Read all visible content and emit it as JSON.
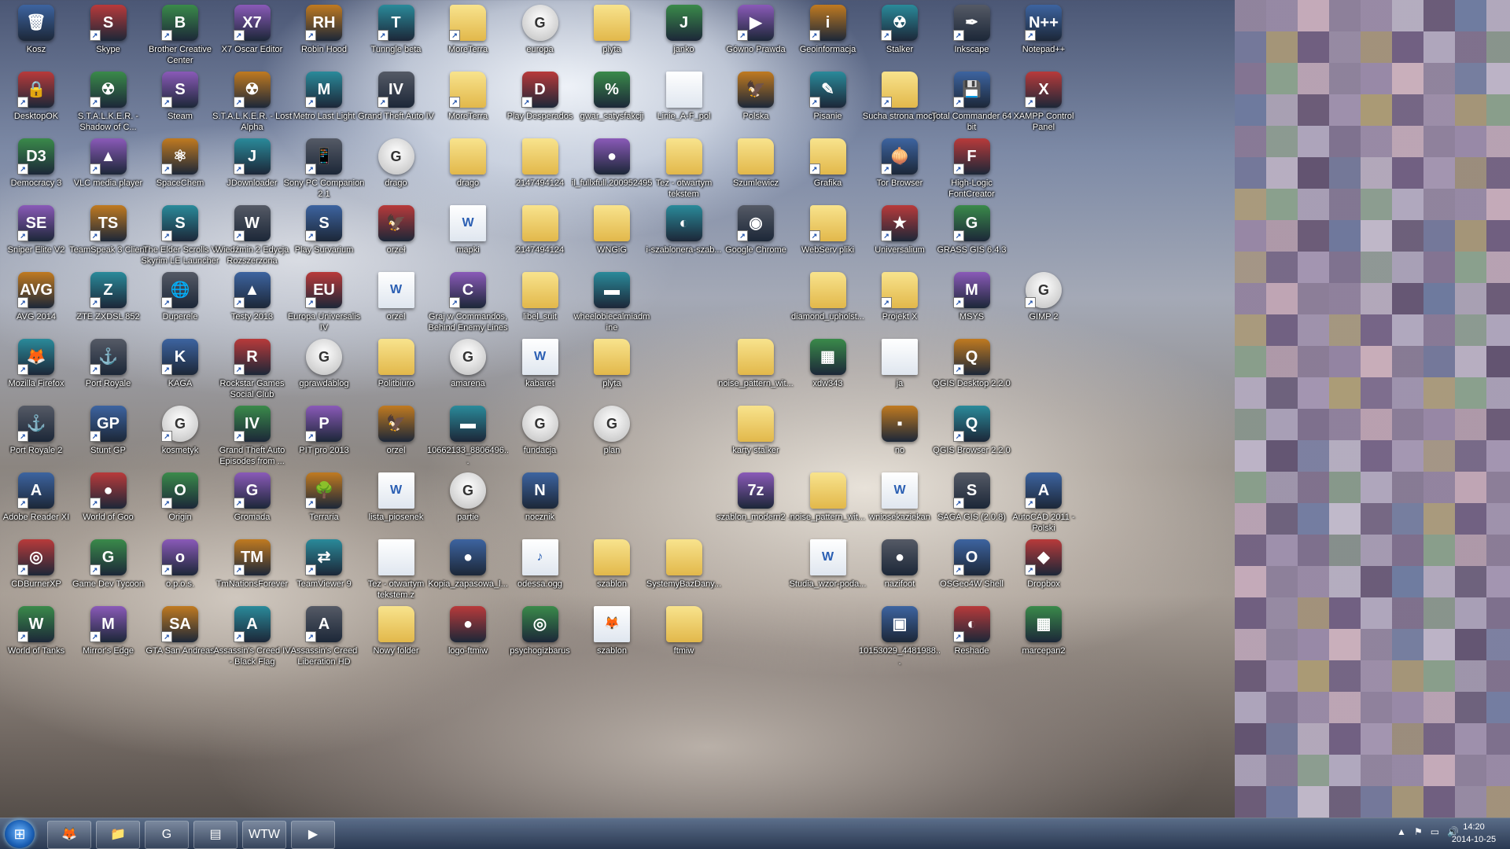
{
  "desktop": {
    "icons": [
      {
        "label": "Kosz",
        "kind": "app",
        "sym": "🗑",
        "shortcut": false
      },
      {
        "label": "Skype",
        "kind": "app",
        "sym": "S",
        "shortcut": true
      },
      {
        "label": "Brother Creative Center",
        "kind": "app",
        "sym": "B",
        "shortcut": true
      },
      {
        "label": "X7 Oscar Editor",
        "kind": "app",
        "sym": "X7",
        "shortcut": true
      },
      {
        "label": "Robin Hood",
        "kind": "app",
        "sym": "RH",
        "shortcut": true
      },
      {
        "label": "Tunngle beta",
        "kind": "app",
        "sym": "T",
        "shortcut": true
      },
      {
        "label": "MoreTerra",
        "kind": "folder",
        "sym": "",
        "shortcut": true
      },
      {
        "label": "europa",
        "kind": "gimp",
        "sym": "G",
        "shortcut": false
      },
      {
        "label": "plyta",
        "kind": "folder",
        "sym": "",
        "shortcut": false
      },
      {
        "label": "janko",
        "kind": "app",
        "sym": "J",
        "shortcut": false
      },
      {
        "label": "Gówno Prawda",
        "kind": "app",
        "sym": "▶",
        "shortcut": true
      },
      {
        "label": "Geoinformacja",
        "kind": "app",
        "sym": "i",
        "shortcut": true
      },
      {
        "label": "Stalker",
        "kind": "app",
        "sym": "☢",
        "shortcut": true
      },
      {
        "label": "Inkscape",
        "kind": "app",
        "sym": "✒",
        "shortcut": true
      },
      {
        "label": "Notepad++",
        "kind": "app",
        "sym": "N++",
        "shortcut": true
      },
      {
        "label": "DesktopOK",
        "kind": "app",
        "sym": "🔒",
        "shortcut": true
      },
      {
        "label": "S.T.A.L.K.E.R. - Shadow of C...",
        "kind": "app",
        "sym": "☢",
        "shortcut": true
      },
      {
        "label": "Steam",
        "kind": "app",
        "sym": "S",
        "shortcut": true
      },
      {
        "label": "S.T.A.L.K.E.R. - Lost Alpha",
        "kind": "app",
        "sym": "☢",
        "shortcut": true
      },
      {
        "label": "Metro Last Light",
        "kind": "app",
        "sym": "M",
        "shortcut": true
      },
      {
        "label": "Grand Theft Auto IV",
        "kind": "app",
        "sym": "IV",
        "shortcut": true
      },
      {
        "label": "MoreTerra",
        "kind": "folder",
        "sym": "",
        "shortcut": true
      },
      {
        "label": "Play Desperados",
        "kind": "app",
        "sym": "D",
        "shortcut": true
      },
      {
        "label": "gwar_satysfakcji",
        "kind": "app",
        "sym": "%",
        "shortcut": false
      },
      {
        "label": "Linie_A-F_pol",
        "kind": "doc",
        "sym": "",
        "shortcut": false
      },
      {
        "label": "Polska",
        "kind": "app",
        "sym": "🦅",
        "shortcut": false
      },
      {
        "label": "Pisanie",
        "kind": "app",
        "sym": "✎",
        "shortcut": true
      },
      {
        "label": "Sucha strona mocy",
        "kind": "folder",
        "sym": "",
        "shortcut": true
      },
      {
        "label": "Total Commander 64 bit",
        "kind": "app",
        "sym": "💾",
        "shortcut": true
      },
      {
        "label": "XAMPP Control Panel",
        "kind": "app",
        "sym": "X",
        "shortcut": true
      },
      {
        "label": "Democracy 3",
        "kind": "app",
        "sym": "D3",
        "shortcut": true
      },
      {
        "label": "VLC media player",
        "kind": "app",
        "sym": "▲",
        "shortcut": true
      },
      {
        "label": "SpaceChem",
        "kind": "app",
        "sym": "⚛",
        "shortcut": true
      },
      {
        "label": "JDownloader",
        "kind": "app",
        "sym": "J",
        "shortcut": true
      },
      {
        "label": "Sony PC Companion 2.1",
        "kind": "app",
        "sym": "📱",
        "shortcut": true
      },
      {
        "label": "drago",
        "kind": "gimp",
        "sym": "G",
        "shortcut": false
      },
      {
        "label": "drago",
        "kind": "folder",
        "sym": "",
        "shortcut": false
      },
      {
        "label": "2147494124",
        "kind": "folder",
        "sym": "",
        "shortcut": false
      },
      {
        "label": "il_fullxfull.200952495",
        "kind": "app",
        "sym": "●",
        "shortcut": false
      },
      {
        "label": "Tez - otwartym tekstem",
        "kind": "folder",
        "sym": "",
        "shortcut": false
      },
      {
        "label": "Szumlewicz",
        "kind": "folder",
        "sym": "",
        "shortcut": false
      },
      {
        "label": "Grafika",
        "kind": "folder",
        "sym": "",
        "shortcut": true
      },
      {
        "label": "Tor Browser",
        "kind": "app",
        "sym": "🧅",
        "shortcut": true
      },
      {
        "label": "High-Logic FontCreator",
        "kind": "app",
        "sym": "F",
        "shortcut": true
      },
      {
        "label": "",
        "kind": "none",
        "sym": "",
        "shortcut": false
      },
      {
        "label": "Sniper Elite V2",
        "kind": "app",
        "sym": "SE",
        "shortcut": true
      },
      {
        "label": "TeamSpeak 3 Client",
        "kind": "app",
        "sym": "TS",
        "shortcut": true
      },
      {
        "label": "The Elder Scrolls V Skyrim LE Launcher",
        "kind": "app",
        "sym": "S",
        "shortcut": true
      },
      {
        "label": "Wiedźmin 2 Edycja Rozszerzona",
        "kind": "app",
        "sym": "W",
        "shortcut": true
      },
      {
        "label": "Play Survarium",
        "kind": "app",
        "sym": "S",
        "shortcut": true
      },
      {
        "label": "orzeł",
        "kind": "app",
        "sym": "🦅",
        "shortcut": false
      },
      {
        "label": "mapki",
        "kind": "doc",
        "sym": "W",
        "shortcut": false
      },
      {
        "label": "2147494124",
        "kind": "folder",
        "sym": "",
        "shortcut": false
      },
      {
        "label": "WNGiG",
        "kind": "folder",
        "sym": "",
        "shortcut": false
      },
      {
        "label": "i-szablonera-szab...",
        "kind": "app",
        "sym": "◐",
        "shortcut": false
      },
      {
        "label": "Google Chrome",
        "kind": "app",
        "sym": "◉",
        "shortcut": true
      },
      {
        "label": "WebServ pliki",
        "kind": "folder",
        "sym": "",
        "shortcut": true
      },
      {
        "label": "Universalium",
        "kind": "app",
        "sym": "★",
        "shortcut": true
      },
      {
        "label": "GRASS GIS 6.4.3",
        "kind": "app",
        "sym": "G",
        "shortcut": true
      },
      {
        "label": "",
        "kind": "none",
        "sym": "",
        "shortcut": false
      },
      {
        "label": "AVG 2014",
        "kind": "app",
        "sym": "AVG",
        "shortcut": true
      },
      {
        "label": "ZTE ZXDSL 852",
        "kind": "app",
        "sym": "Z",
        "shortcut": true
      },
      {
        "label": "Duperele",
        "kind": "app",
        "sym": "🌐",
        "shortcut": true
      },
      {
        "label": "Testy 2013",
        "kind": "app",
        "sym": "▲",
        "shortcut": true
      },
      {
        "label": "Europa Universalis IV",
        "kind": "app",
        "sym": "EU",
        "shortcut": true
      },
      {
        "label": "orzel",
        "kind": "doc",
        "sym": "W",
        "shortcut": false
      },
      {
        "label": "Graj w Commandos, Behind Enemy Lines",
        "kind": "app",
        "sym": "C",
        "shortcut": true
      },
      {
        "label": "libel_suit",
        "kind": "folder",
        "sym": "",
        "shortcut": false
      },
      {
        "label": "wheelobiecalmiadm ine",
        "kind": "app",
        "sym": "▬",
        "shortcut": false
      },
      {
        "label": "",
        "kind": "none",
        "sym": "",
        "shortcut": false
      },
      {
        "label": "",
        "kind": "none",
        "sym": "",
        "shortcut": false
      },
      {
        "label": "diamond_upholst...",
        "kind": "folder",
        "sym": "",
        "shortcut": false
      },
      {
        "label": "Projekt X",
        "kind": "folder",
        "sym": "",
        "shortcut": true
      },
      {
        "label": "MSYS",
        "kind": "app",
        "sym": "M",
        "shortcut": true
      },
      {
        "label": "GIMP 2",
        "kind": "gimp",
        "sym": "G",
        "shortcut": true
      },
      {
        "label": "Mozilla Firefox",
        "kind": "app",
        "sym": "🦊",
        "shortcut": true
      },
      {
        "label": "Port Royale",
        "kind": "app",
        "sym": "⚓",
        "shortcut": true
      },
      {
        "label": "KAGA",
        "kind": "app",
        "sym": "K",
        "shortcut": true
      },
      {
        "label": "Rockstar Games Social Club",
        "kind": "app",
        "sym": "R",
        "shortcut": true
      },
      {
        "label": "gprawdablog",
        "kind": "gimp",
        "sym": "G",
        "shortcut": false
      },
      {
        "label": "Politbiuro",
        "kind": "folder",
        "sym": "",
        "shortcut": false
      },
      {
        "label": "amarena",
        "kind": "gimp",
        "sym": "G",
        "shortcut": false
      },
      {
        "label": "kabaret",
        "kind": "doc",
        "sym": "W",
        "shortcut": false
      },
      {
        "label": "plyta",
        "kind": "folder",
        "sym": "",
        "shortcut": false
      },
      {
        "label": "",
        "kind": "none",
        "sym": "",
        "shortcut": false
      },
      {
        "label": "noise_pattern_wit...",
        "kind": "folder",
        "sym": "",
        "shortcut": false
      },
      {
        "label": "xdw343",
        "kind": "app",
        "sym": "▦",
        "shortcut": false
      },
      {
        "label": "ja",
        "kind": "doc",
        "sym": "",
        "shortcut": false
      },
      {
        "label": "QGIS Desktop 2.2.0",
        "kind": "app",
        "sym": "Q",
        "shortcut": true
      },
      {
        "label": "",
        "kind": "none",
        "sym": "",
        "shortcut": false
      },
      {
        "label": "Port Royale 2",
        "kind": "app",
        "sym": "⚓",
        "shortcut": true
      },
      {
        "label": "Stunt GP",
        "kind": "app",
        "sym": "GP",
        "shortcut": true
      },
      {
        "label": "kosmetyk",
        "kind": "gimp",
        "sym": "G",
        "shortcut": true
      },
      {
        "label": "Grand Theft Auto Episodes from ...",
        "kind": "app",
        "sym": "IV",
        "shortcut": true
      },
      {
        "label": "PIT pro 2013",
        "kind": "app",
        "sym": "P",
        "shortcut": true
      },
      {
        "label": "orzel",
        "kind": "app",
        "sym": "🦅",
        "shortcut": false
      },
      {
        "label": "10662133_8806496...",
        "kind": "app",
        "sym": "▬",
        "shortcut": false
      },
      {
        "label": "fundacja",
        "kind": "gimp",
        "sym": "G",
        "shortcut": false
      },
      {
        "label": "plan",
        "kind": "gimp",
        "sym": "G",
        "shortcut": false
      },
      {
        "label": "",
        "kind": "none",
        "sym": "",
        "shortcut": false
      },
      {
        "label": "karty stalker",
        "kind": "folder",
        "sym": "",
        "shortcut": false
      },
      {
        "label": "",
        "kind": "none",
        "sym": "",
        "shortcut": false
      },
      {
        "label": "no",
        "kind": "app",
        "sym": "▪",
        "shortcut": false
      },
      {
        "label": "QGIS Browser 2.2.0",
        "kind": "app",
        "sym": "Q",
        "shortcut": true
      },
      {
        "label": "",
        "kind": "none",
        "sym": "",
        "shortcut": false
      },
      {
        "label": "Adobe Reader XI",
        "kind": "app",
        "sym": "A",
        "shortcut": true
      },
      {
        "label": "World of Goo",
        "kind": "app",
        "sym": "●",
        "shortcut": true
      },
      {
        "label": "Origin",
        "kind": "app",
        "sym": "O",
        "shortcut": true
      },
      {
        "label": "Gromada",
        "kind": "app",
        "sym": "G",
        "shortcut": true
      },
      {
        "label": "Terraria",
        "kind": "app",
        "sym": "🌳",
        "shortcut": true
      },
      {
        "label": "lista_piosenek",
        "kind": "doc",
        "sym": "W",
        "shortcut": false
      },
      {
        "label": "partie",
        "kind": "gimp",
        "sym": "G",
        "shortcut": false
      },
      {
        "label": "nocznik",
        "kind": "app",
        "sym": "N",
        "shortcut": false
      },
      {
        "label": "",
        "kind": "none",
        "sym": "",
        "shortcut": false
      },
      {
        "label": "",
        "kind": "none",
        "sym": "",
        "shortcut": false
      },
      {
        "label": "szablon_modern2 ...",
        "kind": "app",
        "sym": "7z",
        "shortcut": false
      },
      {
        "label": "noise_pattern_wit...",
        "kind": "folder",
        "sym": "",
        "shortcut": false
      },
      {
        "label": "wniosekaziekan",
        "kind": "doc",
        "sym": "W",
        "shortcut": false
      },
      {
        "label": "SAGA GIS (2.0.8)",
        "kind": "app",
        "sym": "S",
        "shortcut": true
      },
      {
        "label": "AutoCAD 2011 - Polski",
        "kind": "app",
        "sym": "A",
        "shortcut": true
      },
      {
        "label": "CDBurnerXP",
        "kind": "app",
        "sym": "◎",
        "shortcut": true
      },
      {
        "label": "Game Dev Tycoon",
        "kind": "app",
        "sym": "G",
        "shortcut": true
      },
      {
        "label": "o.p.o.s.",
        "kind": "app",
        "sym": "o",
        "shortcut": true
      },
      {
        "label": "TmNationsForever",
        "kind": "app",
        "sym": "TM",
        "shortcut": true
      },
      {
        "label": "TeamViewer 9",
        "kind": "app",
        "sym": "⇄",
        "shortcut": true
      },
      {
        "label": "Tez - otwartym tekstem.z",
        "kind": "doc",
        "sym": "",
        "shortcut": false
      },
      {
        "label": "Kopia_zapasowa_l...",
        "kind": "app",
        "sym": "●",
        "shortcut": false
      },
      {
        "label": "odessa.ogg",
        "kind": "doc",
        "sym": "♪",
        "shortcut": false
      },
      {
        "label": "szablon",
        "kind": "folder",
        "sym": "",
        "shortcut": false
      },
      {
        "label": "SystemyBazDany...",
        "kind": "folder",
        "sym": "",
        "shortcut": false
      },
      {
        "label": "",
        "kind": "none",
        "sym": "",
        "shortcut": false
      },
      {
        "label": "Studia_wzor-poda...",
        "kind": "doc",
        "sym": "W",
        "shortcut": false
      },
      {
        "label": "nazifoot",
        "kind": "app",
        "sym": "●",
        "shortcut": false
      },
      {
        "label": "OSGeo4W Shell",
        "kind": "app",
        "sym": "O",
        "shortcut": true
      },
      {
        "label": "Dropbox",
        "kind": "app",
        "sym": "◆",
        "shortcut": true
      },
      {
        "label": "World of Tanks",
        "kind": "app",
        "sym": "W",
        "shortcut": true
      },
      {
        "label": "Mirror's Edge",
        "kind": "app",
        "sym": "M",
        "shortcut": true
      },
      {
        "label": "GTA San Andreas",
        "kind": "app",
        "sym": "SA",
        "shortcut": true
      },
      {
        "label": "Assassin's Creed IV - Black Flag",
        "kind": "app",
        "sym": "A",
        "shortcut": true
      },
      {
        "label": "Assassin's Creed Liberation HD",
        "kind": "app",
        "sym": "A",
        "shortcut": true
      },
      {
        "label": "Nowy folder",
        "kind": "folder",
        "sym": "",
        "shortcut": false
      },
      {
        "label": "logo-ftmiw",
        "kind": "app",
        "sym": "●",
        "shortcut": false
      },
      {
        "label": "psychogizbarus",
        "kind": "app",
        "sym": "◎",
        "shortcut": false
      },
      {
        "label": "szablon",
        "kind": "doc",
        "sym": "🦊",
        "shortcut": false
      },
      {
        "label": "ftmiw",
        "kind": "folder",
        "sym": "",
        "shortcut": false
      },
      {
        "label": "",
        "kind": "none",
        "sym": "",
        "shortcut": false
      },
      {
        "label": "",
        "kind": "none",
        "sym": "",
        "shortcut": false
      },
      {
        "label": "10153029_4481988...",
        "kind": "app",
        "sym": "▣",
        "shortcut": false
      },
      {
        "label": "Reshade",
        "kind": "app",
        "sym": "◐",
        "shortcut": true
      },
      {
        "label": "marcepan2",
        "kind": "app",
        "sym": "▦",
        "shortcut": false
      }
    ]
  },
  "taskbar": {
    "start_label": "⊞",
    "buttons": [
      {
        "name": "firefox",
        "sym": "🦊"
      },
      {
        "name": "explorer",
        "sym": "📁"
      },
      {
        "name": "gimp",
        "sym": "G"
      },
      {
        "name": "chart-app",
        "sym": "▤"
      },
      {
        "name": "wtw",
        "sym": "WTW"
      },
      {
        "name": "media-player",
        "sym": "▶"
      }
    ],
    "tray_icons": [
      "▲",
      "⚑",
      "▭",
      "🔊"
    ],
    "time": "14:20",
    "date": "2014-10-25"
  },
  "colors": {
    "folder": "#e8c25a",
    "app_default": "#3d64a0",
    "taskbar": "#2b3b55"
  }
}
